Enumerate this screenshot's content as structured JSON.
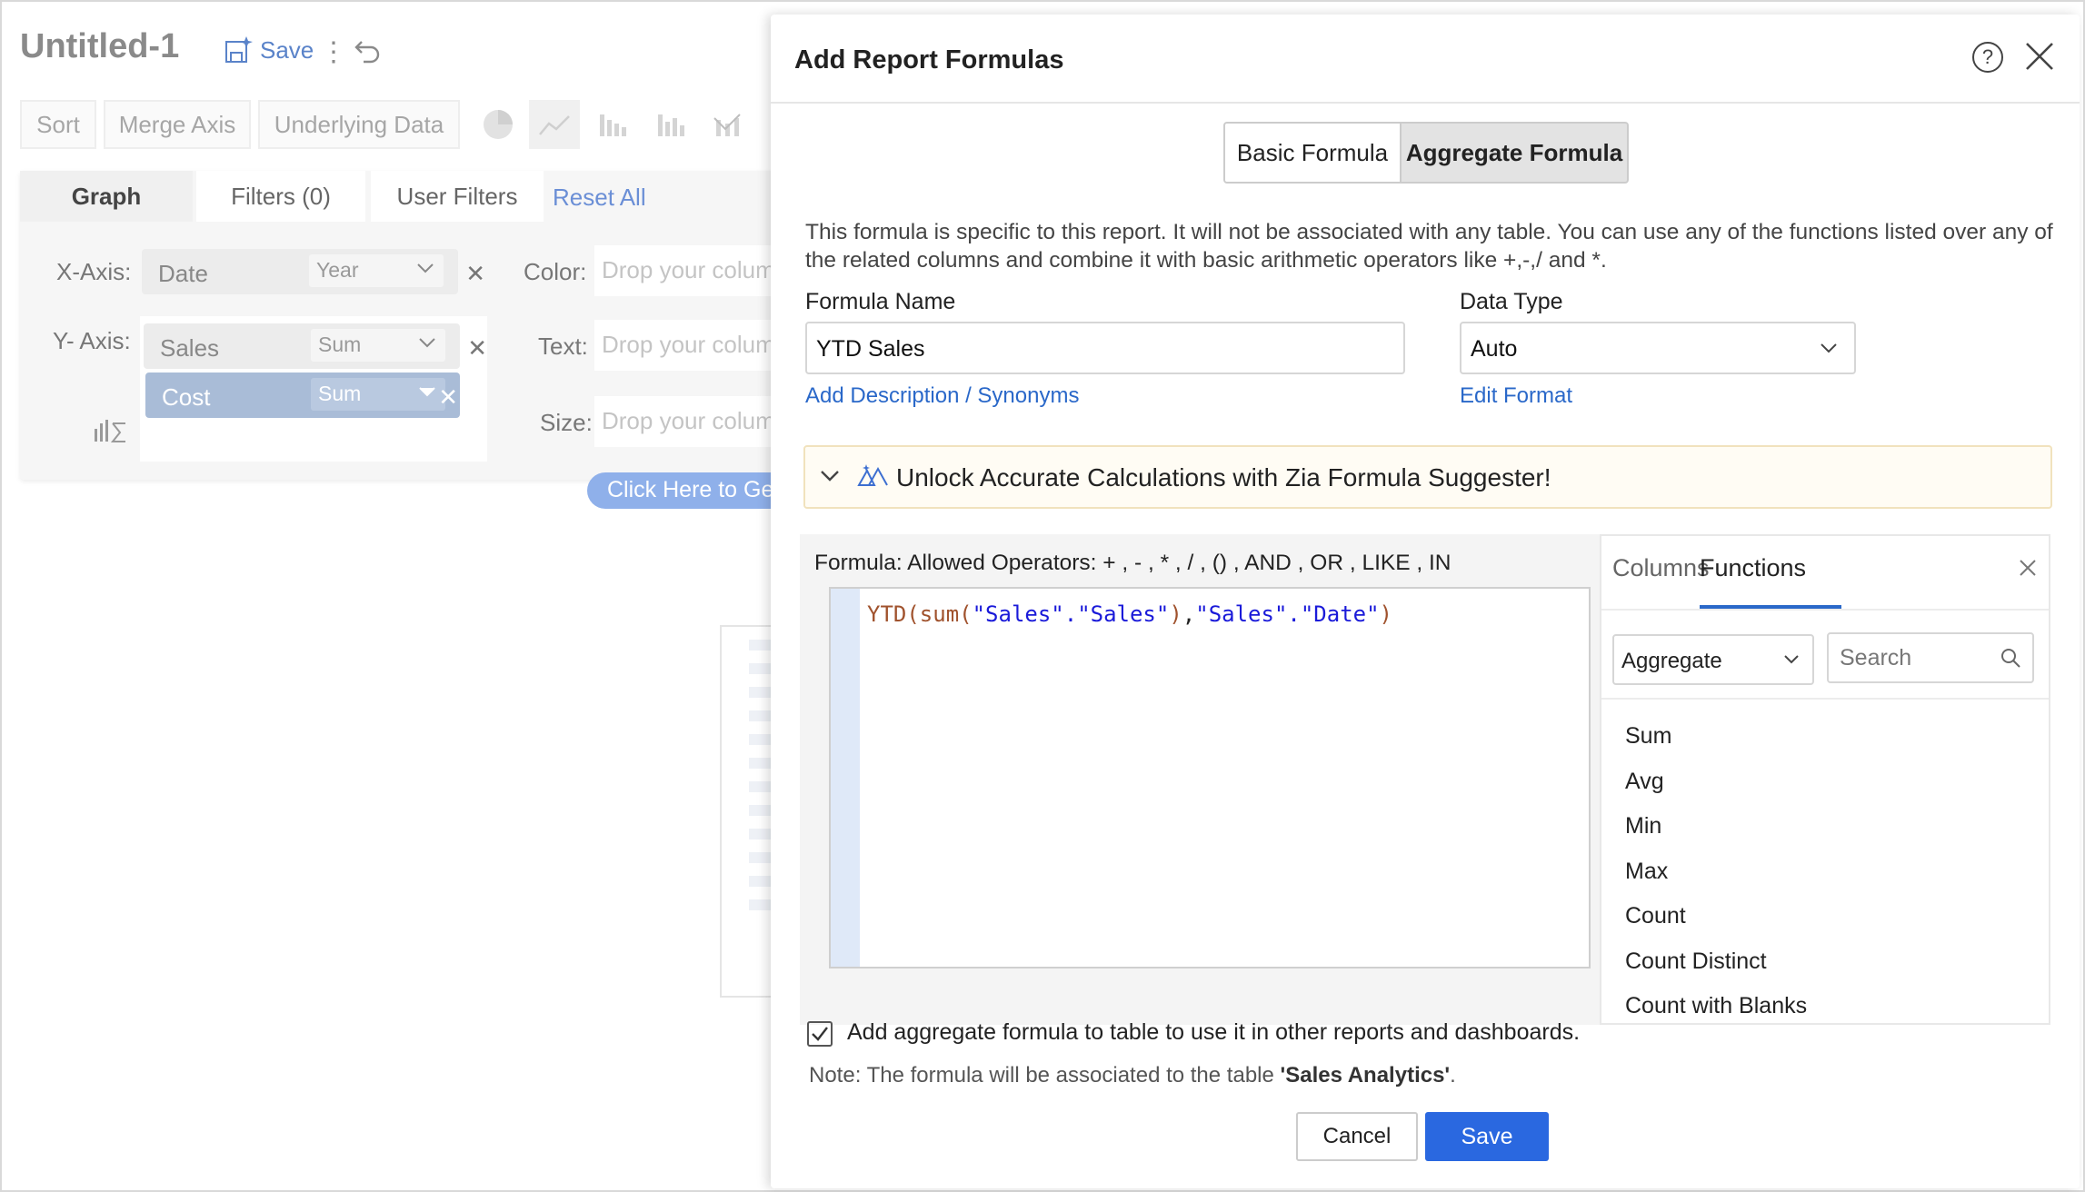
{
  "app": {
    "title": "Untitled-1",
    "save_label": "Save"
  },
  "toolbar": {
    "sort": "Sort",
    "merge_axis": "Merge Axis",
    "underlying_data": "Underlying Data"
  },
  "panel": {
    "tabs": [
      "Graph",
      "Filters  (0)",
      "User Filters"
    ],
    "reset_all": "Reset All",
    "x_axis_label": "X-Axis:",
    "y_axis_label": "Y- Axis:",
    "x_axis": {
      "column": "Date",
      "agg": "Year"
    },
    "y_axis": [
      {
        "column": "Sales",
        "agg": "Sum"
      },
      {
        "column": "Cost",
        "agg": "Sum"
      }
    ],
    "color_label": "Color:",
    "text_label": "Text:",
    "size_label": "Size:",
    "drop_placeholder": "Drop your column",
    "click_here": "Click Here to Ge"
  },
  "modal": {
    "title": "Add Report Formulas",
    "tabs": {
      "basic": "Basic Formula",
      "aggregate": "Aggregate Formula"
    },
    "description": "This formula is specific to this report. It will not be associated with any table. You can use any of the functions listed over any of the related columns and combine it with basic arithmetic operators like +,-,/ and *.",
    "formula_name_label": "Formula Name",
    "formula_name_value": "YTD Sales",
    "add_description": "Add Description / Synonyms",
    "data_type_label": "Data Type",
    "data_type_value": "Auto",
    "edit_format": "Edit Format",
    "zia_banner": "Unlock Accurate Calculations with Zia Formula Suggester!",
    "formula_label": "Formula: Allowed Operators: + , - , * , / , () , AND , OR , LIKE , IN",
    "formula_code": {
      "fn1": "YTD(",
      "fn2": "sum(",
      "s1": "\"Sales\".\"Sales\"",
      "p1": ")",
      "comma": ",",
      "s2": "\"Sales\".\"Date\"",
      "p2": ")"
    },
    "side": {
      "tab_columns": "Columns",
      "tab_functions": "Functions",
      "category": "Aggregate",
      "search_placeholder": "Search",
      "functions": [
        "Sum",
        "Avg",
        "Min",
        "Max",
        "Count",
        "Count Distinct",
        "Count with Blanks"
      ]
    },
    "checkbox_label": "Add aggregate formula to table to use it in other reports and dashboards.",
    "checkbox_checked": true,
    "note_prefix": "Note: The formula will be associated to the table ",
    "note_table": "'Sales Analytics'",
    "note_suffix": ".",
    "cancel": "Cancel",
    "save": "Save"
  }
}
